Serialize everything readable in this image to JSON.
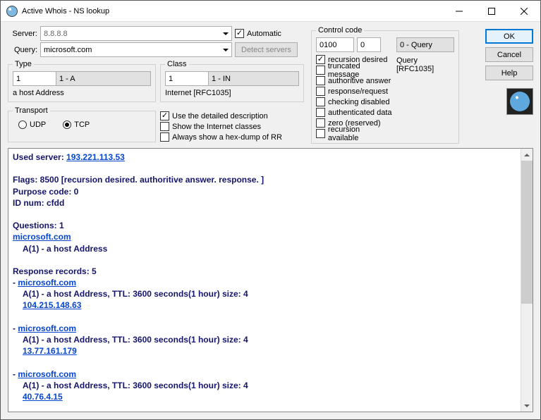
{
  "title": "Active Whois - NS lookup",
  "labels": {
    "server": "Server:",
    "query": "Query:"
  },
  "server": {
    "value": "8.8.8.8"
  },
  "query": {
    "value": "microsoft.com"
  },
  "automatic": {
    "label": "Automatic",
    "checked": true
  },
  "detect_servers": "Detect servers",
  "type": {
    "legend": "Type",
    "num": "1",
    "sel": "1 - A",
    "desc": "a host Address"
  },
  "class": {
    "legend": "Class",
    "num": "1",
    "sel": "1 - IN",
    "desc": "Internet [RFC1035]"
  },
  "opts": {
    "detailed": {
      "label": "Use the detailed description",
      "checked": true
    },
    "show_classes": {
      "label": "Show the Internet classes",
      "checked": false
    },
    "hex_dump": {
      "label": "Always show a hex-dump of RR",
      "checked": false
    }
  },
  "transport": {
    "legend": "Transport",
    "udp": "UDP",
    "tcp": "TCP",
    "selected": "tcp"
  },
  "control_code": {
    "legend": "Control code",
    "val1": "0100",
    "val2": "0",
    "sel": "0 - Query",
    "flags": {
      "recursion_desired": {
        "label": "recursion desired",
        "checked": true
      },
      "truncated_message": {
        "label": "truncated message",
        "checked": false
      },
      "authoritive_answer": {
        "label": "authoritive answer",
        "checked": false
      },
      "response_request": {
        "label": "response/request",
        "checked": false
      },
      "checking_disabled": {
        "label": "checking disabled",
        "checked": false
      },
      "authenticated_data": {
        "label": "authenticated data",
        "checked": false
      },
      "zero_reserved": {
        "label": "zero (reserved)",
        "checked": false
      },
      "recursion_available": {
        "label": "recursion available",
        "checked": false
      }
    },
    "query_label": "Query [RFC1035]"
  },
  "buttons": {
    "ok": "OK",
    "cancel": "Cancel",
    "help": "Help"
  },
  "output": {
    "used_server_label": "Used server: ",
    "used_server": "193.221.113.53",
    "flags": "Flags: 8500 [recursion desired. authoritive answer. response. ]",
    "purpose": "Purpose code: 0",
    "idnum": "ID num: cfdd",
    "questions": "Questions: 1",
    "q_host": "microsoft.com",
    "q_desc": "A(1) - a host Address",
    "response": "Response records: 5",
    "records": [
      {
        "host": "microsoft.com",
        "desc": "A(1) - a host Address, TTL: 3600 seconds(1 hour) size: 4",
        "ip": "104.215.148.63"
      },
      {
        "host": "microsoft.com",
        "desc": "A(1) - a host Address, TTL: 3600 seconds(1 hour) size: 4",
        "ip": "13.77.161.179"
      },
      {
        "host": "microsoft.com",
        "desc": "A(1) - a host Address, TTL: 3600 seconds(1 hour) size: 4",
        "ip": "40.76.4.15"
      }
    ]
  }
}
